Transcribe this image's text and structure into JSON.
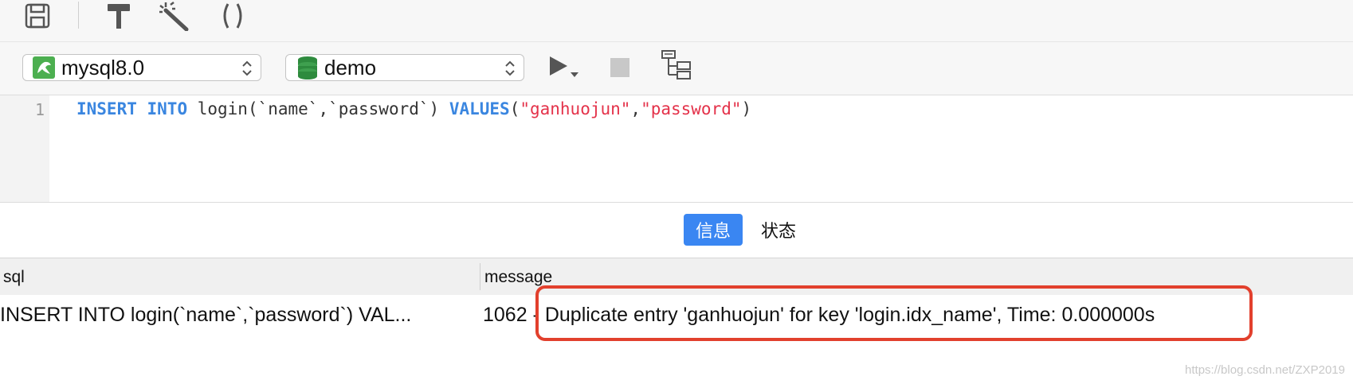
{
  "toolbar": {
    "icons": [
      "save-icon",
      "hammer-icon",
      "magic-wand-icon",
      "parentheses-icon"
    ]
  },
  "connection_bar": {
    "connection": "mysql8.0",
    "database": "demo",
    "icons": [
      "dolphin-icon",
      "database-icon",
      "run-icon",
      "stop-icon",
      "explain-icon"
    ]
  },
  "editor": {
    "line_number": "1",
    "tokens": {
      "insert": "INSERT",
      "into": "INTO",
      "table_part": " login(`name`,`password`) ",
      "values": "VALUES",
      "open_paren": "(",
      "str1": "\"ganhuojun\"",
      "comma": ",",
      "str2": "\"password\"",
      "close_paren": ")"
    }
  },
  "tabs": [
    {
      "label": "信息",
      "active": true
    },
    {
      "label": "状态",
      "active": false
    }
  ],
  "results": {
    "columns": [
      "sql",
      "message"
    ],
    "rows": [
      {
        "sql": "INSERT INTO login(`name`,`password`) VAL...",
        "message": "1062 - Duplicate entry 'ganhuojun' for key 'login.idx_name', Time: 0.000000s"
      }
    ]
  },
  "colors": {
    "keyword": "#3a86e0",
    "string": "#e4324a",
    "tab_active": "#3a86f2",
    "annotation": "#e2402d"
  },
  "watermark": "https://blog.csdn.net/ZXP2019"
}
